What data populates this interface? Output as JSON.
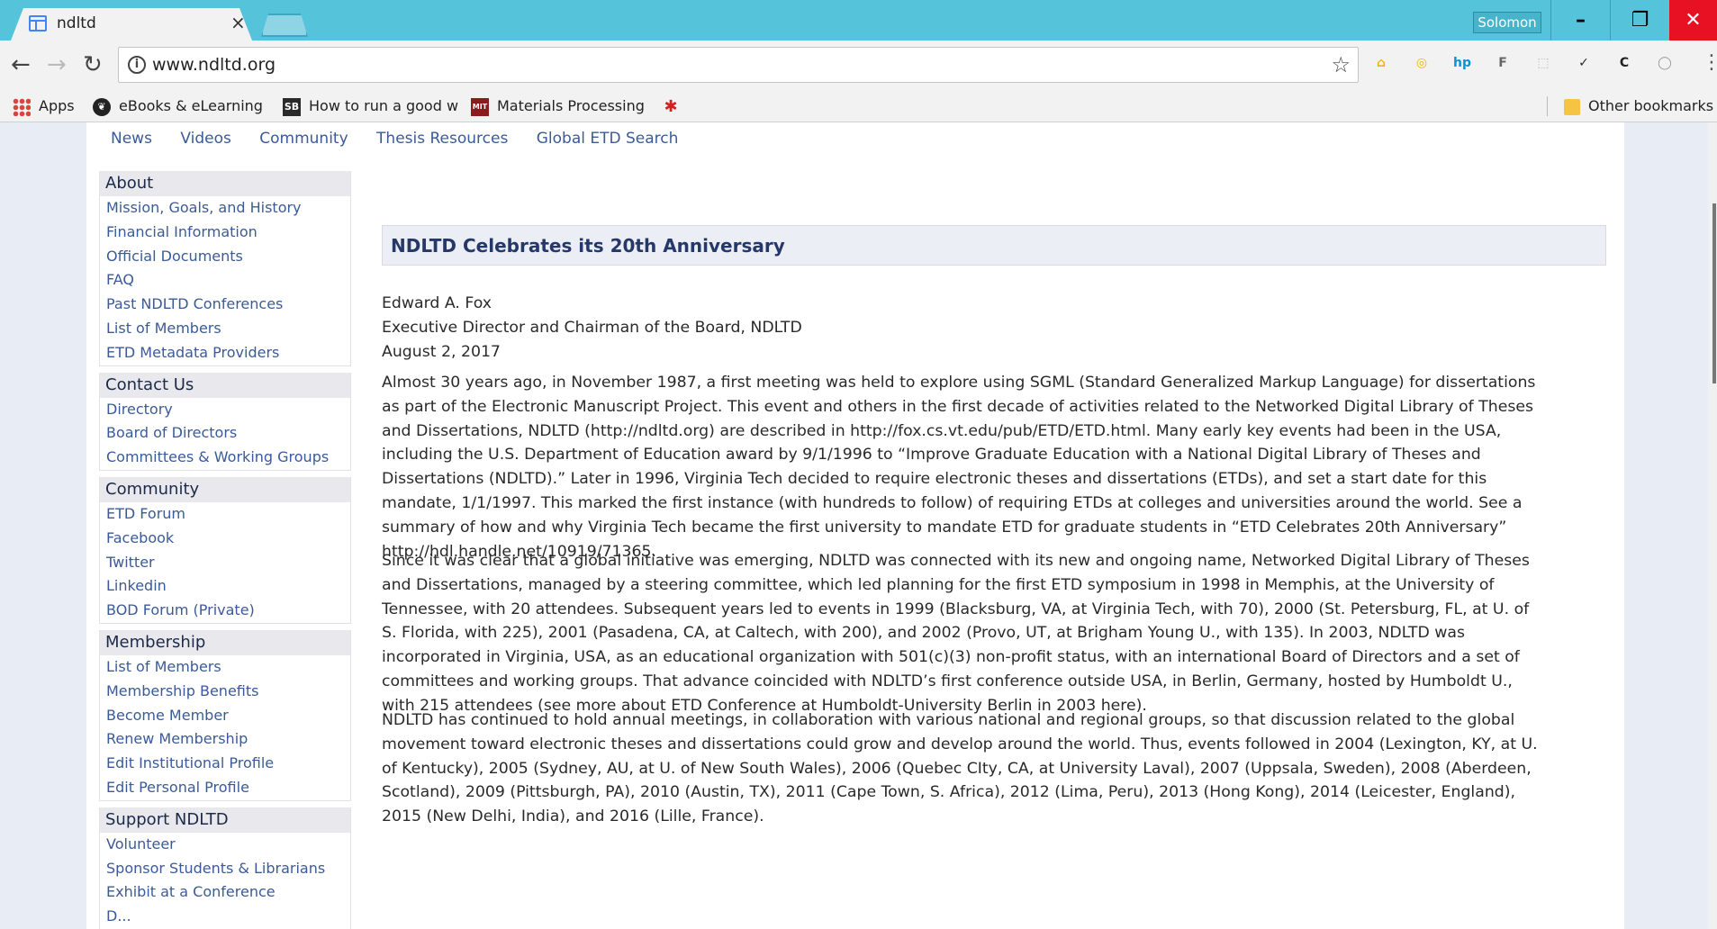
{
  "browser": {
    "tab_title": "ndltd",
    "tab_close": "×",
    "profile_name": "Solomon",
    "url": "www.ndltd.org",
    "window_controls": {
      "minimize": "–",
      "maximize": "❐",
      "close": "✕"
    },
    "nav": {
      "back": "←",
      "forward": "→",
      "reload": "↻"
    },
    "star": "☆",
    "menu": "⋮",
    "extensions": [
      {
        "name": "home-extension-icon",
        "glyph": "⌂",
        "color": "#f4b400"
      },
      {
        "name": "search-extension-icon",
        "glyph": "◎",
        "color": "#f4b400"
      },
      {
        "name": "hp-extension-icon",
        "glyph": "hp",
        "color": "#0096d6"
      },
      {
        "name": "f-extension-icon",
        "glyph": "F",
        "color": "#666666"
      },
      {
        "name": "pdf-extension-icon",
        "glyph": "⬚",
        "color": "#bbbbbb"
      },
      {
        "name": "check-extension-icon",
        "glyph": "✓",
        "color": "#2a2a2a"
      },
      {
        "name": "c-extension-icon",
        "glyph": "C",
        "color": "#222222"
      },
      {
        "name": "github-extension-icon",
        "glyph": "◯",
        "color": "#999999"
      }
    ]
  },
  "bookmarks": {
    "apps": "Apps",
    "items": [
      {
        "label": "eBooks & eLearning",
        "icon": "leaf-icon"
      },
      {
        "label": "How to run a good w",
        "icon": "sb-icon"
      },
      {
        "label": "Materials Processing",
        "icon": "mit-icon"
      }
    ],
    "extra_icon": "red-star-icon",
    "other": "Other bookmarks"
  },
  "topnav": [
    "News",
    "Videos",
    "Community",
    "Thesis Resources",
    "Global ETD Search"
  ],
  "sidebar": [
    {
      "title": "About",
      "items": [
        "Mission, Goals, and History",
        "Financial Information",
        "Official Documents",
        "FAQ",
        "Past NDLTD Conferences",
        "List of Members",
        "ETD Metadata Providers"
      ]
    },
    {
      "title": "Contact Us",
      "items": [
        "Directory",
        "Board of Directors",
        "Committees & Working Groups"
      ]
    },
    {
      "title": "Community",
      "items": [
        "ETD Forum",
        "Facebook",
        "Twitter",
        "Linkedin",
        "BOD Forum (Private)"
      ]
    },
    {
      "title": "Membership",
      "items": [
        "List of Members",
        "Membership Benefits",
        "Become Member",
        "Renew Membership",
        "Edit Institutional Profile",
        "Edit Personal Profile"
      ]
    },
    {
      "title": "Support NDLTD",
      "items": [
        "Volunteer",
        "Sponsor Students & Librarians",
        "Exhibit at a Conference",
        "D..."
      ]
    }
  ],
  "article": {
    "headline": "NDLTD Celebrates its 20th Anniversary",
    "byline": [
      "Edward A. Fox",
      "Executive Director and Chairman of the Board, NDLTD",
      "August 2, 2017"
    ],
    "p1": [
      "Almost 30 years ago, in November 1987, a first meeting was held to explore using SGML (Standard Generalized Markup Language) for dissertations",
      "as part of the Electronic Manuscript Project.  This event and others in the first decade of activities related to the Networked Digital Library of Theses",
      "and Dissertations, NDLTD (http://ndltd.org) are described in http://fox.cs.vt.edu/pub/ETD/ETD.html. Many early key events had been in the USA,",
      "including the U.S. Department of Education award by 9/1/1996 to “Improve Graduate Education with a National Digital Library of Theses and",
      "Dissertations (NDLTD).”  Later in 1996, Virginia Tech decided to require electronic theses and dissertations (ETDs), and set a start date for this",
      "mandate, 1/1/1997. This marked the first instance (with hundreds to follow) of requiring ETDs at colleges and universities around the world. See a",
      "summary of how and why Virginia Tech became the first university to mandate ETD for graduate students in “ETD Celebrates 20th Anniversary”",
      "http://hdl.handle.net/10919/71365."
    ],
    "p2": [
      "Since it was clear that a global initiative was emerging, NDLTD was connected with its new and ongoing name, Networked Digital Library of Theses",
      "and Dissertations, managed by a steering committee, which led planning for the first ETD symposium in 1998 in Memphis, at the University of",
      "Tennessee, with 20 attendees. Subsequent years led to events in 1999 (Blacksburg, VA, at Virginia Tech, with 70), 2000 (St. Petersburg, FL, at U. of",
      "S. Florida, with 225), 2001 (Pasadena, CA, at Caltech, with 200), and 2002 (Provo, UT, at Brigham Young U., with 135). In 2003, NDLTD was",
      "incorporated in Virginia, USA, as an educational organization with 501(c)(3) non-profit status, with an international Board of Directors and a set of",
      "committees and working groups. That advance coincided with NDLTD’s first conference outside USA, in Berlin, Germany, hosted by Humboldt U.,",
      "with 215 attendees (see more about ETD Conference at Humboldt-University Berlin in 2003 here)."
    ],
    "p3": [
      "NDLTD has continued to hold annual meetings, in collaboration with various national and regional groups, so that discussion related to the global",
      "movement toward electronic theses and dissertations could grow and develop around the world. Thus, events followed in 2004 (Lexington, KY, at U.",
      "of Kentucky), 2005 (Sydney, AU, at U. of New South Wales), 2006 (Quebec CIty, CA, at University Laval), 2007 (Uppsala, Sweden), 2008 (Aberdeen,",
      "Scotland), 2009 (Pittsburgh, PA), 2010 (Austin, TX), 2011 (Cape Town, S. Africa), 2012 (Lima, Peru), 2013 (Hong Kong), 2014 (Leicester, England),",
      "2015 (New Delhi, India), and 2016 (Lille, France)."
    ]
  }
}
